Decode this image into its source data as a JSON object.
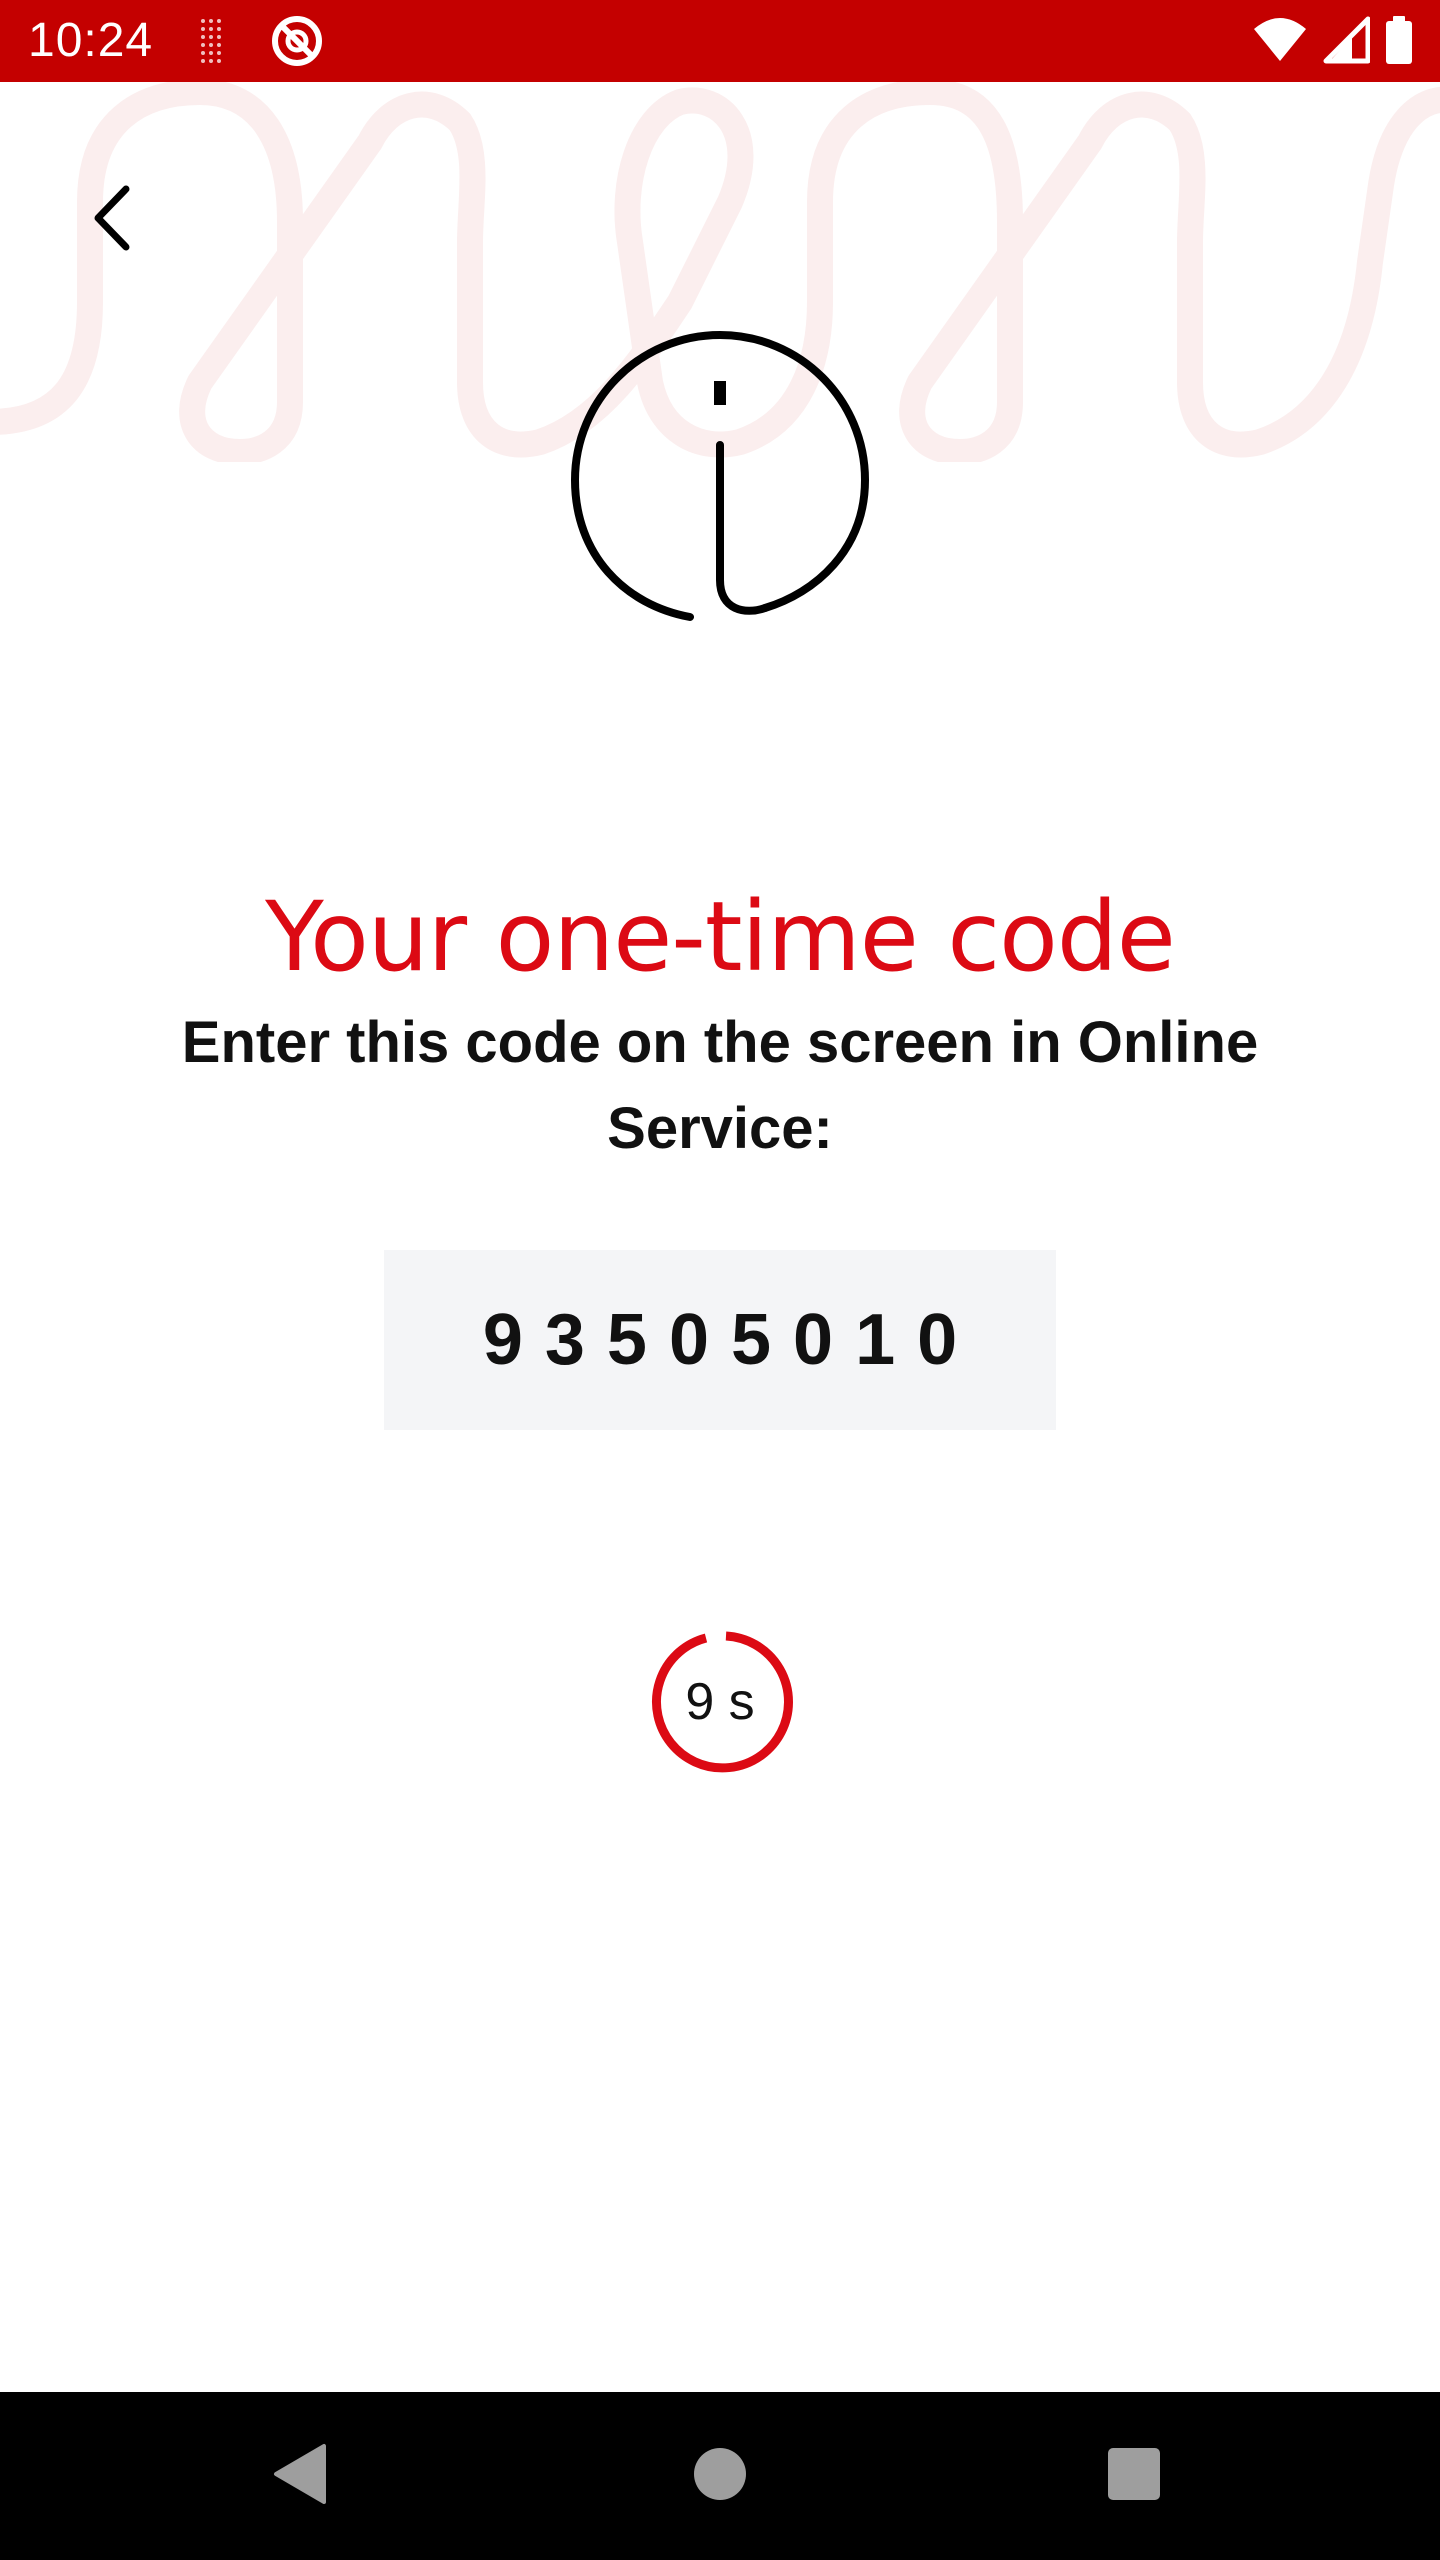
{
  "status_bar": {
    "time": "10:24",
    "background_color": "#c40000",
    "icons_left": [
      "dotted-signal-icon",
      "blocked-notification-icon"
    ],
    "icons_right": [
      "wifi-icon",
      "cell-signal-icon",
      "battery-icon"
    ]
  },
  "header": {
    "back_icon": "chevron-left-icon"
  },
  "main": {
    "icon": "info-icon",
    "title": "Your one-time code",
    "title_color": "#dc0a14",
    "instruction": "Enter this code on the screen in Online Service:",
    "code": "93505010",
    "countdown": {
      "label": "9 s",
      "accent_color": "#dc0a14"
    }
  },
  "nav_bar": {
    "buttons": [
      "back-triangle-icon",
      "home-circle-icon",
      "recents-square-icon"
    ]
  }
}
